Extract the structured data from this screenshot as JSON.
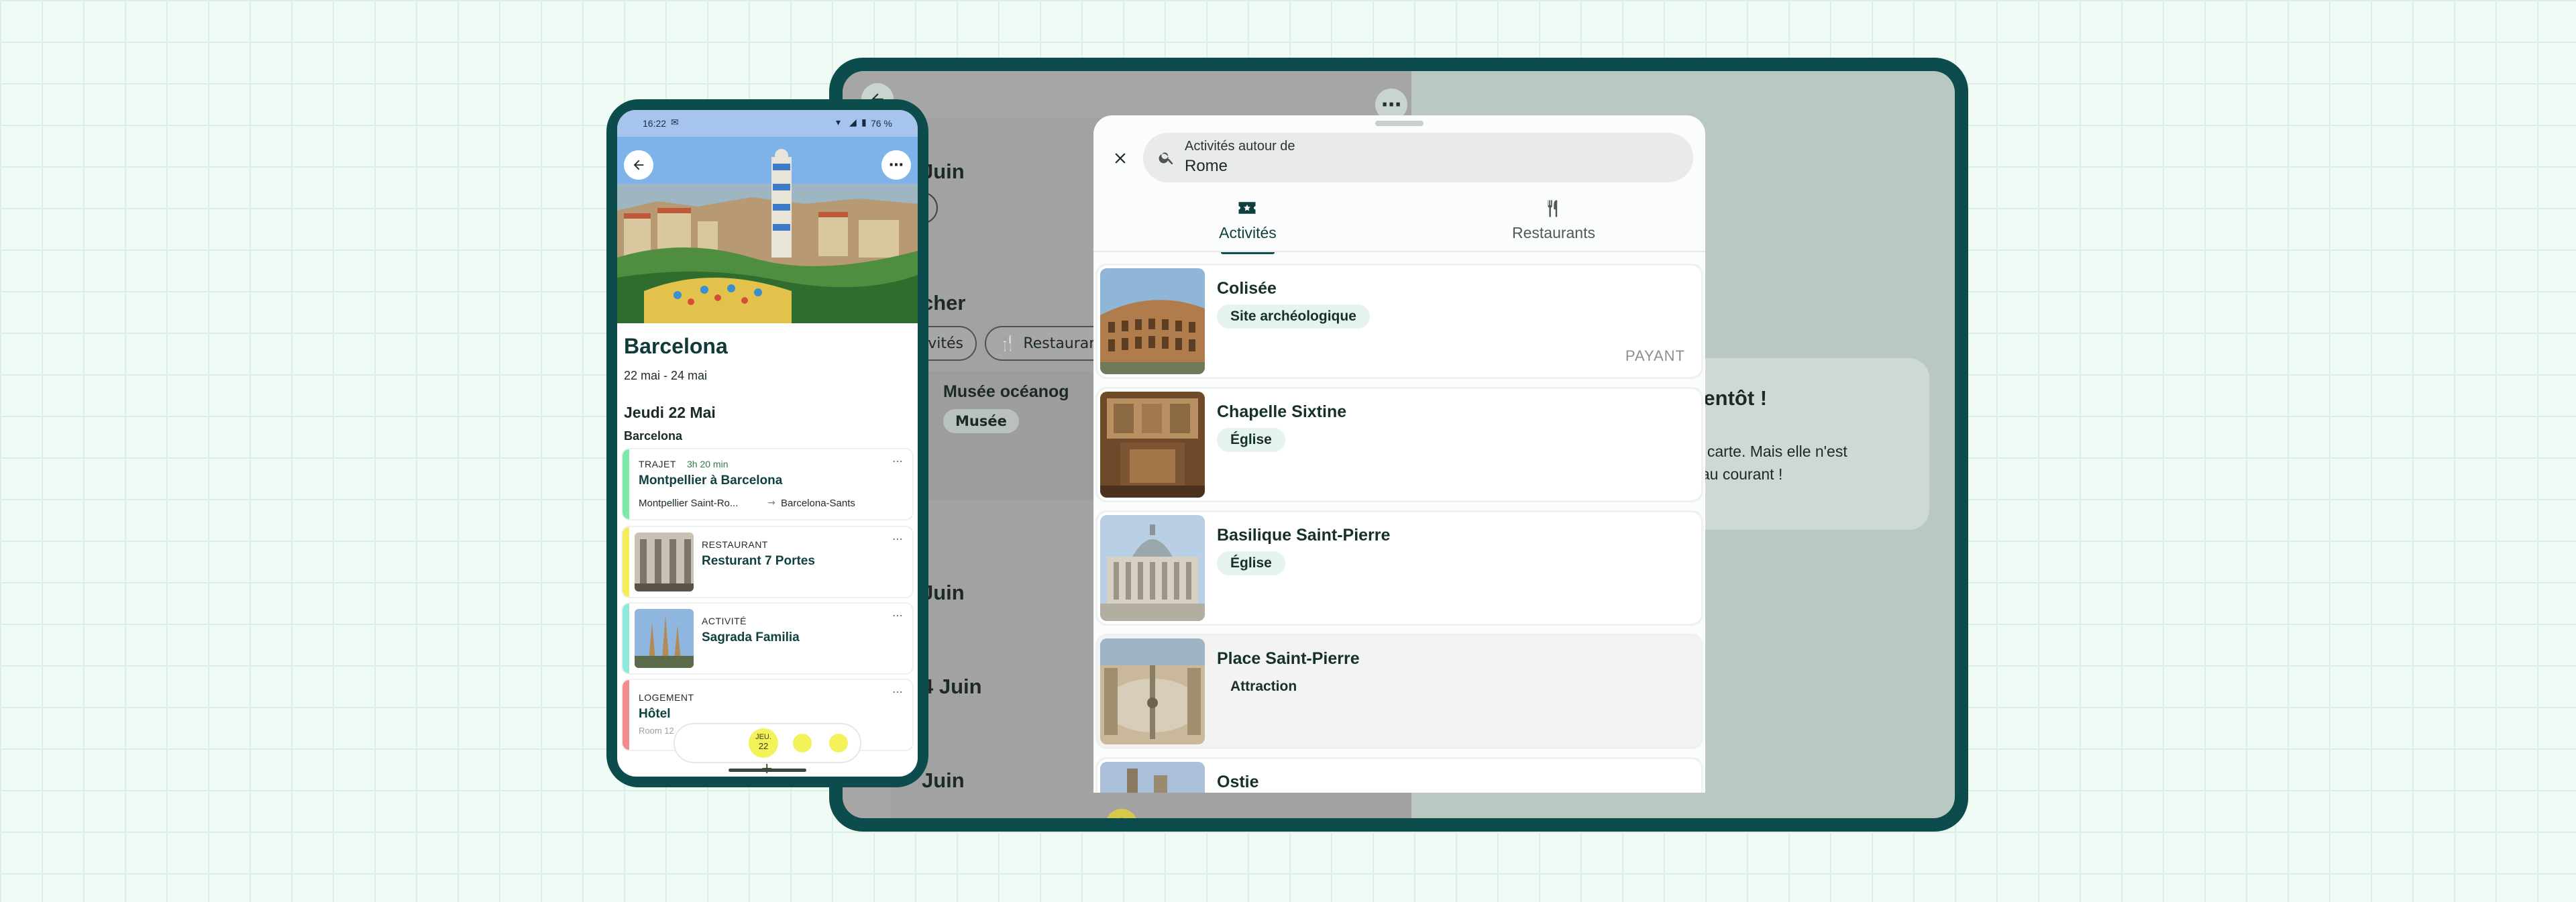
{
  "tablet": {
    "back_icon": "arrow-left-icon",
    "more_icon": "more-horizontal-icon",
    "dates": [
      "Juin",
      "Juin",
      "4 Juin",
      "Juin"
    ],
    "chip_search_label": "cher",
    "chips": [
      "ivités",
      "Restaurant"
    ],
    "card_title": "Musée océanog",
    "card_tag": "Musée",
    "info_title": "e bientôt !",
    "info_text_1": "r une carte. Mais elle n'est",
    "info_text_2": "tient au courant !",
    "add_label": "+"
  },
  "sheet": {
    "close_icon": "close-icon",
    "search_icon": "search-icon",
    "search_label": "Activités autour de",
    "search_value": "Rome",
    "tabs": [
      {
        "label": "Activités",
        "icon": "ticket-icon",
        "active": true
      },
      {
        "label": "Restaurants",
        "icon": "cutlery-icon",
        "active": false
      }
    ],
    "results": [
      {
        "title": "Colisée",
        "tag": "Site archéologique",
        "price": "PAYANT"
      },
      {
        "title": "Chapelle Sixtine",
        "tag": "Église"
      },
      {
        "title": "Basilique Saint-Pierre",
        "tag": "Église"
      },
      {
        "title": "Place Saint-Pierre",
        "tag": "Attraction"
      },
      {
        "title": "Ostie"
      }
    ]
  },
  "phone": {
    "status_time": "16:22",
    "status_battery": "76 %",
    "back_icon": "arrow-left-icon",
    "more_icon": "more-horizontal-icon",
    "trip_title": "Barcelona",
    "trip_dates": "22 mai - 24 mai",
    "day_title": "Jeudi 22 Mai",
    "day_city": "Barcelona",
    "items": [
      {
        "type": "TRAJET",
        "duration": "3h 20 min",
        "title": "Montpellier à Barcelona",
        "from": "Montpellier Saint-Ro...",
        "to": "Barcelona-Sants",
        "color": "#7ee8a8"
      },
      {
        "type": "RESTAURANT",
        "title": "Resturant 7 Portes",
        "color": "#f4ec5a"
      },
      {
        "type": "ACTIVITÉ",
        "title": "Sagrada Familia",
        "color": "#8fe8dc"
      },
      {
        "type": "LOGEMENT",
        "title": "Hôtel",
        "sub": "Room 12",
        "color": "#f28b8b"
      }
    ],
    "day_nav_label_1": "JEU.",
    "day_nav_label_2": "22",
    "add_label": "+"
  }
}
